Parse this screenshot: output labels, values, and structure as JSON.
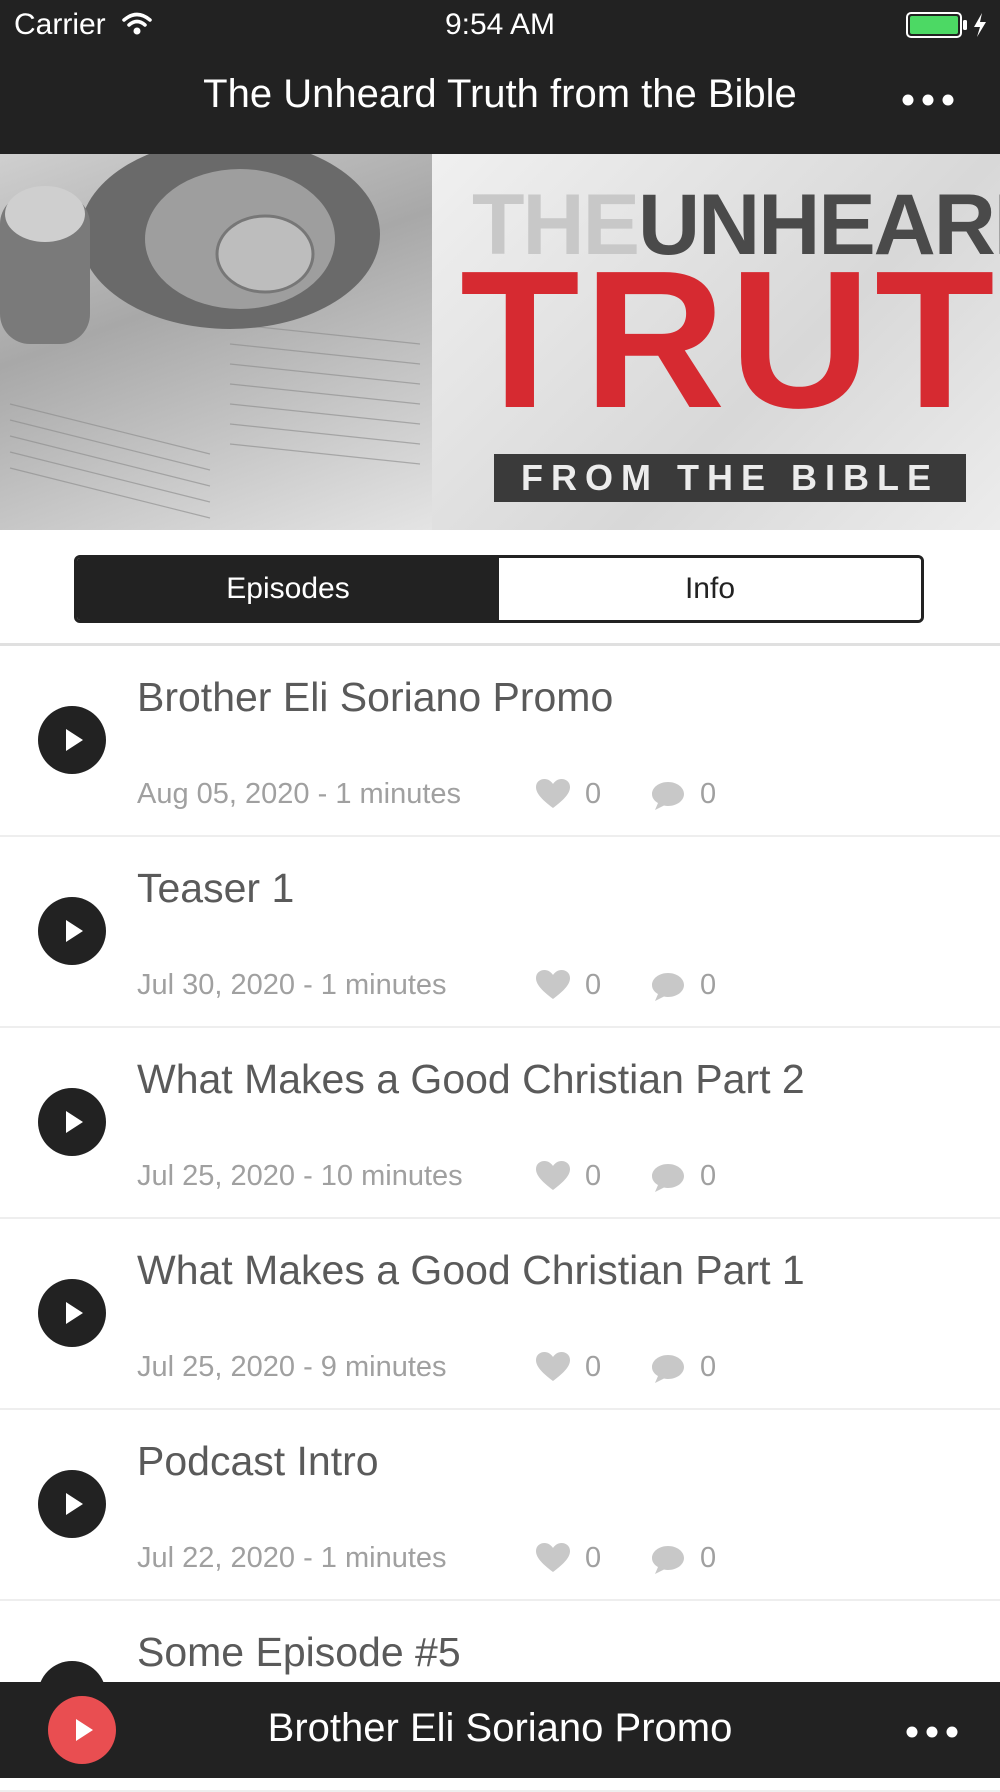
{
  "status_bar": {
    "carrier": "Carrier",
    "time": "9:54 AM",
    "battery_color": "#4cd964"
  },
  "nav": {
    "title": "The Unheard Truth from the Bible",
    "more_icon": "more-dots-icon"
  },
  "banner": {
    "logo_the": "THE",
    "logo_unheard": "UNHEARD",
    "logo_truth": "TRUTH",
    "logo_from": "FROM THE BIBLE",
    "logo_red": "#d62a31"
  },
  "tabs": {
    "episodes_label": "Episodes",
    "info_label": "Info",
    "selected": "Episodes"
  },
  "episodes": [
    {
      "title": "Brother Eli Soriano Promo",
      "meta": "Aug 05, 2020 - 1 minutes",
      "likes": "0",
      "comments": "0"
    },
    {
      "title": "Teaser 1",
      "meta": "Jul 30, 2020 - 1 minutes",
      "likes": "0",
      "comments": "0"
    },
    {
      "title": "What Makes a Good Christian Part 2",
      "meta": "Jul 25, 2020 - 10 minutes",
      "likes": "0",
      "comments": "0"
    },
    {
      "title": "What Makes a Good Christian Part 1",
      "meta": "Jul 25, 2020 - 9 minutes",
      "likes": "0",
      "comments": "0"
    },
    {
      "title": "Podcast Intro",
      "meta": "Jul 22, 2020 - 1 minutes",
      "likes": "0",
      "comments": "0"
    },
    {
      "title": "Some Episode #5",
      "meta": "",
      "likes": "",
      "comments": ""
    }
  ],
  "player": {
    "now_playing": "Brother Eli Soriano Promo",
    "accent": "#e94e51"
  }
}
